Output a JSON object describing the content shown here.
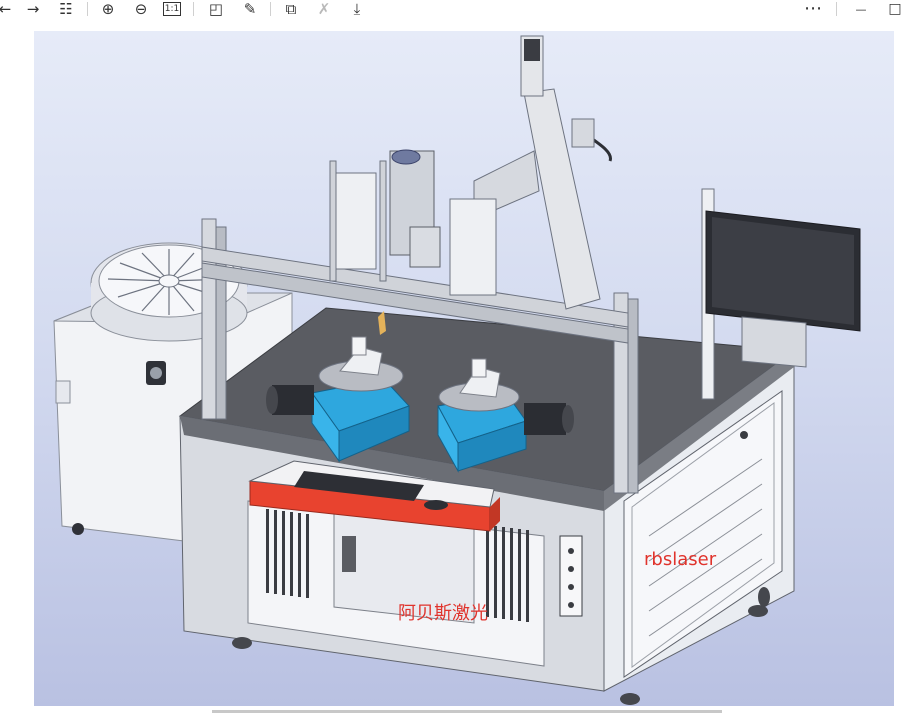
{
  "toolbar": {
    "left": [
      {
        "name": "back-icon",
        "glyph": "←",
        "enabled": true
      },
      {
        "name": "forward-icon",
        "glyph": "→",
        "enabled": true
      },
      {
        "name": "grid-view-icon",
        "glyph": "☷",
        "enabled": true
      },
      {
        "name": "zoom-in-icon",
        "glyph": "⊕",
        "enabled": true
      },
      {
        "name": "zoom-out-icon",
        "glyph": "⊖",
        "enabled": true
      },
      {
        "name": "actual-size-icon",
        "glyph": "1:1",
        "enabled": true
      },
      {
        "name": "rotate-icon",
        "glyph": "◰",
        "enabled": true
      },
      {
        "name": "edit-icon",
        "glyph": "✎",
        "enabled": true
      },
      {
        "name": "crop-icon",
        "glyph": "⧉",
        "enabled": true
      },
      {
        "name": "transform-icon",
        "glyph": "✗",
        "enabled": false
      },
      {
        "name": "download-icon",
        "glyph": "⤓",
        "enabled": true
      }
    ],
    "right": [
      {
        "name": "more-icon",
        "glyph": "⋯"
      },
      {
        "name": "minimize-icon",
        "glyph": "—"
      },
      {
        "name": "maximize-icon",
        "glyph": "□"
      }
    ]
  },
  "image": {
    "watermark_brand": "rbslaser",
    "watermark_company": "阿贝斯激光"
  },
  "colors": {
    "viewer_bg_top": "#e6ebf8",
    "viewer_bg_bottom": "#b9c1e2",
    "table_top": "#5a5c62",
    "cabinet": "#e9ecf1",
    "drawer_red": "#e8432f",
    "rotary_blue": "#29a8e0",
    "watermark": "#e0332c"
  }
}
